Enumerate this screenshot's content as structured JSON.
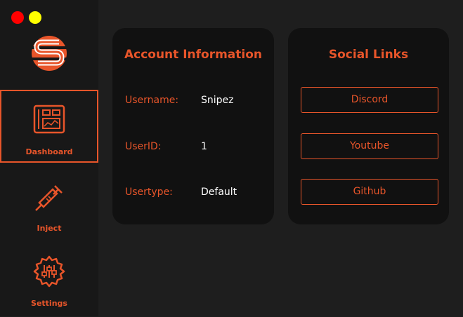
{
  "sidebar": {
    "logo": "s-logo",
    "items": [
      {
        "label": "Dashboard",
        "icon": "dashboard-icon",
        "active": true
      },
      {
        "label": "Inject",
        "icon": "syringe-icon",
        "active": false
      },
      {
        "label": "Settings",
        "icon": "gear-sliders-icon",
        "active": false
      }
    ]
  },
  "account": {
    "title": "Account Information",
    "rows": [
      {
        "label": "Username:",
        "value": "Snipez"
      },
      {
        "label": "UserID:",
        "value": "1"
      },
      {
        "label": "Usertype:",
        "value": "Default"
      }
    ]
  },
  "social": {
    "title": "Social Links",
    "links": [
      {
        "label": "Discord"
      },
      {
        "label": "Youtube"
      },
      {
        "label": "Github"
      }
    ]
  },
  "colors": {
    "accent": "#e8552a",
    "background": "#1e1e1e",
    "sidebar": "#181818",
    "card": "#111111",
    "close_dot": "#ff0000",
    "minimize_dot": "#ffff00"
  }
}
